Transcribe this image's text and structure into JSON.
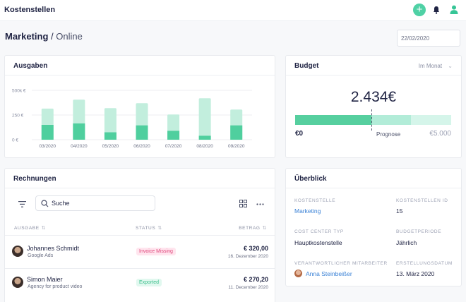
{
  "app": {
    "title": "Kostenstellen"
  },
  "header": {
    "title_main": "Marketing",
    "title_sep": " / ",
    "title_sub": "Online",
    "date": "22/02/2020"
  },
  "ausgaben": {
    "title": "Ausgaben",
    "colors": {
      "dark": "#4fcf9e",
      "light": "#c2eedd"
    }
  },
  "chart_data": {
    "type": "bar",
    "title": "Ausgaben",
    "categories": [
      "03/2020",
      "04/2020",
      "05/2020",
      "06/2020",
      "07/2020",
      "08/2020",
      "09/2020"
    ],
    "series": [
      {
        "values": [
          150,
          165,
          75,
          145,
          90,
          40,
          145
        ]
      },
      {
        "values": [
          315,
          405,
          320,
          370,
          255,
          420,
          305
        ]
      }
    ],
    "y_ticks": [
      "500k €",
      "250 €",
      "0 €"
    ],
    "ylim": [
      0,
      500
    ],
    "grid": true
  },
  "budget": {
    "title": "Budget",
    "period": "Im Monat",
    "amount": "2.434€",
    "start_label": "€0",
    "prognose_label": "Prognose",
    "end_label": "€5.000",
    "spent_fraction": 0.487,
    "prognose_fraction": 0.74,
    "colors": {
      "fill": "#56cf9f",
      "prognose": "#b2ecd8",
      "track": "#d5f5ea"
    }
  },
  "rechnungen": {
    "title": "Rechnungen",
    "search_placeholder": "Suche",
    "columns": {
      "ausgabe": "AUSGABE",
      "status": "STATUS",
      "betrag": "BETRAG"
    },
    "rows": [
      {
        "name": "Johannes Schmidt",
        "sub": "Google Ads",
        "status": "Invoice Missing",
        "amount": "€ 320,00",
        "date": "16. Dezember 2020"
      },
      {
        "name": "Simon Maier",
        "sub": "Agency for product video",
        "status": "Exported",
        "amount": "€ 270,20",
        "date": "11. December 2020"
      }
    ]
  },
  "ueberblick": {
    "title": "Überblick",
    "fields": {
      "kostenstelle_label": "KOSTENSTELLE",
      "kostenstelle_value": "Marketing",
      "id_label": "KOSTENSTELLEN ID",
      "id_value": "15",
      "typ_label": "COST CENTER TYP",
      "typ_value": "Hauptkostenstelle",
      "periode_label": "BUDGETPERIODE",
      "periode_value": "Jährlich",
      "mitarbeiter_label": "VERANTWORTLICHER MITARBEITER",
      "mitarbeiter_value": "Anna Steinbeißer",
      "datum_label": "ERSTELLUNGSDATUM",
      "datum_value": "13. März 2020"
    }
  }
}
